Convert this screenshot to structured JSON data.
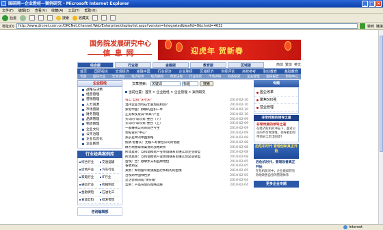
{
  "window": {
    "title": "国研网—企业胜经—案例研究 - Microsoft Internet Explorer"
  },
  "menu": [
    "文件(F)",
    "编辑(E)",
    "查看(V)",
    "收藏(A)",
    "工具(T)",
    "帮助(H)"
  ],
  "toolbar": {
    "back": "后退",
    "search": "搜索",
    "favorites": "收藏夹"
  },
  "address": {
    "label": "地址(D)",
    "url": "http://www.drcnet.com.cn/DRCNet.Channel.Web/Enterprise/displaylist.aspx?version=Integrated&leafid=8&chnid=4632",
    "go": "转到",
    "links": "链接"
  },
  "status": {
    "left": "",
    "zone": "Internet"
  },
  "site": {
    "logo_line1": "国务院发展研究中心",
    "logo_line2": "信息网",
    "banner_text": "迎虎年 贺新春",
    "tabs": [
      "综合版",
      "行业版",
      "金融版",
      "教育版",
      "区域版"
    ],
    "lang": [
      "简体",
      "繁体",
      "英文"
    ],
    "nav1": [
      "首页",
      "国研视点",
      "宏观经济",
      "金融中国",
      "行业经济",
      "企业胜经",
      "区域经济",
      "世经评论",
      "高校参考",
      "职业教育",
      "基础教育"
    ],
    "nav2": [
      "专题",
      "国研文丛",
      "宏观调控",
      "经济形势",
      "经济要闻",
      "政策法规",
      "行业研究",
      "市场调研",
      "商务研究",
      "企业管理",
      "国研报告",
      "帮助中心"
    ],
    "sidebar_title": "企业胜经",
    "sidebar_items": [
      "战略与决策",
      "经营管理",
      "营销管理",
      "人力资源",
      "市场营销",
      "财务管理",
      "品牌管理",
      "物流管理",
      "企业文化",
      "公司治理",
      "企业信息化",
      "企业民营"
    ],
    "cases_title": "行业经典案例库",
    "cases": [
      "综合行业",
      "交通运输",
      "房地产业",
      "汽车行业",
      "家电行业",
      "IT行业",
      "通信行业",
      "机械制造",
      "金融保险",
      "石油化工",
      "食品饮料",
      "批发零售"
    ],
    "sidebar_footer": "咨询编辑部",
    "search": {
      "label": "文章搜索：",
      "value": "关键词",
      "select": "标题",
      "button": "搜索"
    },
    "breadcrumb": "当前位置：首页 > 企业胜经 > 企业管理 > 案例研究",
    "articles": [
      {
        "title": "钱工\"自撰\"沃尔沃？",
        "date": "2010-02-10"
      },
      {
        "title": "温州企业为何在年底加班利润？",
        "date": "2010-02-10"
      },
      {
        "title": "索尼中国：静静的回扣一年",
        "date": "2010-02-10"
      },
      {
        "title": "正览科技及其\"新兵\"产业",
        "date": "2010-02-10"
      },
      {
        "title": "天马的\"软饮式\"整合（下）",
        "date": "2010-02-09"
      },
      {
        "title": "天马的\"软饮式\"整合（上）",
        "date": "2010-02-09"
      },
      {
        "title": "一家赚钱公司的前世今生",
        "date": "2010-02-09"
      },
      {
        "title": "零投资的\"中心\"",
        "date": "2010-02-09"
      },
      {
        "title": "燕京是中的中国策略",
        "date": "2010-02-09"
      },
      {
        "title": "统销·借鲁实：无敌人寿保险公司的借题",
        "date": "2010-02-08"
      },
      {
        "title": "精力地重取销渠道的战略转折",
        "date": "2010-02-08"
      },
      {
        "title": "所调奥莱：以和谐模式产业协调联系思维实现企业转型",
        "date": "2010-02-08"
      },
      {
        "title": "所调奥莱：以和谐模式产业协调联系思维实现企业转型",
        "date": "2010-02-08"
      },
      {
        "title": "古埃广告：顺攀步天和品牌地位",
        "date": "2010-02-05"
      },
      {
        "title": "谷歌到这",
        "date": "2010-02-05"
      },
      {
        "title": "案例：如何摆平新旗舰品行和权的的困境",
        "date": "2010-02-05"
      },
      {
        "title": "百视商中国绿色梦",
        "date": "2010-02-05"
      },
      {
        "title": "灵活营销的成\"领头雁\"",
        "date": "2010-02-04"
      },
      {
        "title": "案例：产品背后的策略选择",
        "date": "2010-02-04"
      }
    ],
    "right_head": "专题",
    "right_links": [
      "国企改革",
      "聚焦500强",
      "营业管理"
    ],
    "right_bar": "非常时期的领导之道",
    "right_t1": "非常时期的领导之道",
    "right_p1": "在经济危机的冲击下，面对公司的不可预测性，领导者如何带领员工走出困境？",
    "right_blue": "后危机时代 管理创新真正开始",
    "right_t2": "后危机时代，管理改善真正开始",
    "right_p2": "在危机状况中，企业能如何有效地改善自身的管理体系",
    "right_btn": "更多企业专题"
  }
}
